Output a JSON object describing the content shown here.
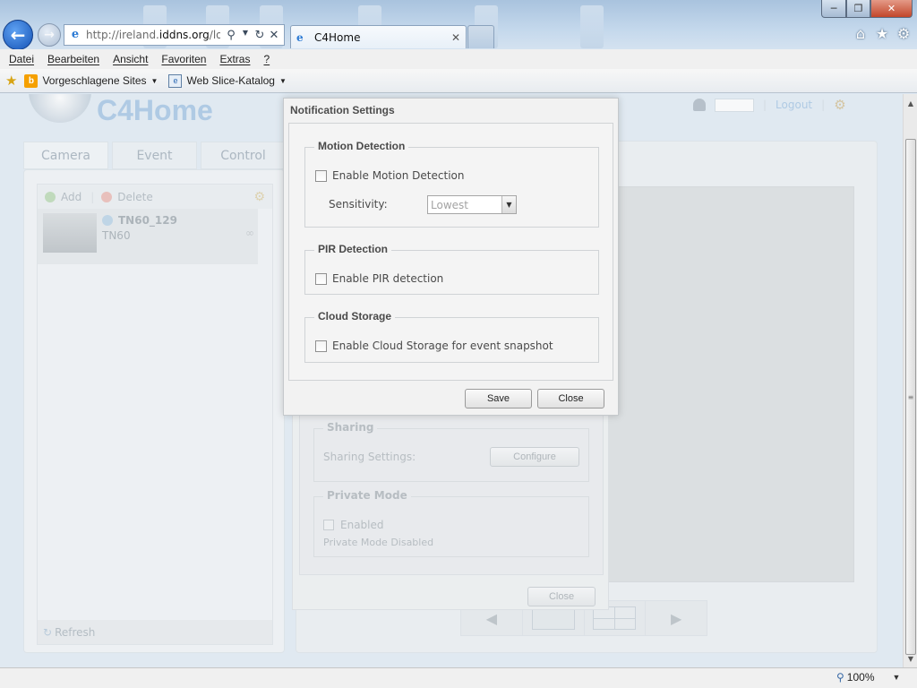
{
  "browser": {
    "address": {
      "url_prefix": "http://ireland.",
      "url_domain": "iddns.org",
      "url_suffix": "/login",
      "favicon": "e-icon"
    },
    "tab": {
      "title": "C4Home",
      "close": "✕"
    },
    "menu": [
      "Datei",
      "Bearbeiten",
      "Ansicht",
      "Favoriten",
      "Extras",
      "?"
    ],
    "favorites": {
      "suggested_sites": "Vorgeschlagene Sites",
      "web_slice": "Web Slice-Katalog"
    },
    "zoom": "100%",
    "colors": {
      "chrome": "#c4d8ec",
      "back_button": "#1553b6",
      "close_button": "#c2462a"
    }
  },
  "page": {
    "logo": "C4Home",
    "logout": "Logout",
    "tabs": [
      "Camera",
      "Event",
      "Control"
    ],
    "toolbar": {
      "add": "Add",
      "delete": "Delete"
    },
    "camera": {
      "name": "TN60_129",
      "model": "TN60"
    },
    "refresh": "Refresh",
    "camera_settings": {
      "sharing_legend": "Sharing",
      "sharing_label": "Sharing Settings:",
      "configure": "Configure",
      "private_legend": "Private Mode",
      "enabled_label": "Enabled",
      "private_status": "Private Mode Disabled",
      "close": "Close"
    }
  },
  "dialog": {
    "title": "Notification Settings",
    "motion": {
      "legend": "Motion Detection",
      "checkbox_label": "Enable Motion Detection",
      "checked": false,
      "sensitivity_label": "Sensitivity:",
      "sensitivity_value": "Lowest"
    },
    "pir": {
      "legend": "PIR Detection",
      "checkbox_label": "Enable PIR detection",
      "checked": false
    },
    "cloud": {
      "legend": "Cloud Storage",
      "checkbox_label": "Enable Cloud Storage for event snapshot",
      "checked": false
    },
    "save": "Save",
    "close": "Close"
  }
}
